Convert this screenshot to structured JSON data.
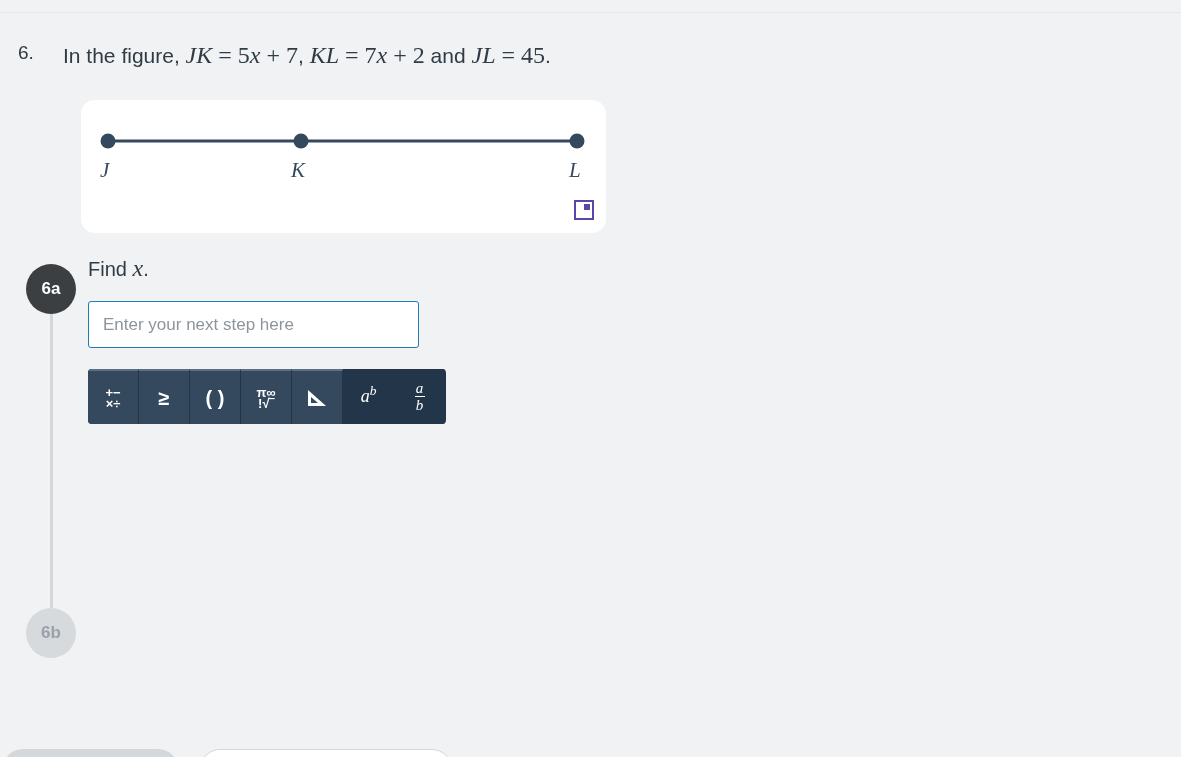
{
  "question": {
    "number": "6.",
    "parts": [
      {
        "kind": "text",
        "text": "In the figure, "
      },
      {
        "kind": "var",
        "text": "JK"
      },
      {
        "kind": "sym",
        "text": " = 5"
      },
      {
        "kind": "var",
        "text": "x"
      },
      {
        "kind": "sym",
        "text": " + 7"
      },
      {
        "kind": "text",
        "text": ", "
      },
      {
        "kind": "var",
        "text": "KL"
      },
      {
        "kind": "sym",
        "text": " = 7"
      },
      {
        "kind": "var",
        "text": "x"
      },
      {
        "kind": "sym",
        "text": " + 2"
      },
      {
        "kind": "text",
        "text": " and "
      },
      {
        "kind": "var",
        "text": "JL"
      },
      {
        "kind": "sym",
        "text": " = 45"
      },
      {
        "kind": "text",
        "text": "."
      }
    ]
  },
  "figure": {
    "points": [
      {
        "label": "J"
      },
      {
        "label": "K"
      },
      {
        "label": "L"
      }
    ]
  },
  "steps": [
    {
      "label": "6a",
      "active": true,
      "prompt": [
        {
          "kind": "text",
          "text": "Find "
        },
        {
          "kind": "var",
          "text": "x"
        },
        {
          "kind": "text",
          "text": "."
        }
      ],
      "input": {
        "placeholder": "Enter your next step here"
      },
      "toolbar": [
        {
          "kind": "stack",
          "top": "+−",
          "bottom": "×÷"
        },
        {
          "kind": "plain",
          "text": "≥"
        },
        {
          "kind": "plain",
          "text": "( )"
        },
        {
          "kind": "stack",
          "top": "π∞",
          "bottom": "!√‾"
        },
        {
          "kind": "triangle"
        },
        {
          "kind": "power",
          "base": "a",
          "exp": "b"
        },
        {
          "kind": "fraction",
          "num": "a",
          "den": "b"
        }
      ]
    },
    {
      "label": "6b",
      "active": false
    }
  ]
}
